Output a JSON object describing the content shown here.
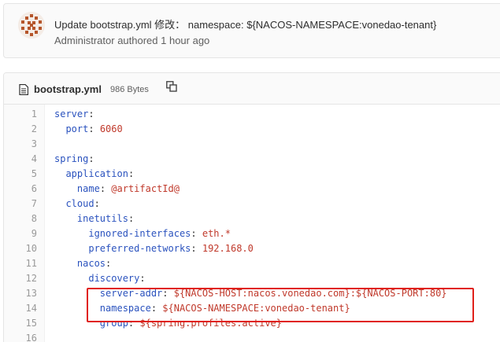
{
  "commit": {
    "title": "Update bootstrap.yml 修改： namespace: ${NACOS-NAMESPACE:vonedao-tenant}",
    "meta": "Administrator authored 1 hour ago",
    "avatar_icon": "identicon-avatar"
  },
  "file": {
    "name": "bootstrap.yml",
    "size": "986 Bytes",
    "icon": "file-icon",
    "copy_icon": "copy-icon"
  },
  "code_lines": [
    {
      "n": "1",
      "indent": "",
      "key": "server",
      "sep": ":",
      "val": ""
    },
    {
      "n": "2",
      "indent": "  ",
      "key": "port",
      "sep": ": ",
      "val": "6060"
    },
    {
      "n": "3",
      "indent": "",
      "key": "",
      "sep": "",
      "val": ""
    },
    {
      "n": "4",
      "indent": "",
      "key": "spring",
      "sep": ":",
      "val": ""
    },
    {
      "n": "5",
      "indent": "  ",
      "key": "application",
      "sep": ":",
      "val": ""
    },
    {
      "n": "6",
      "indent": "    ",
      "key": "name",
      "sep": ": ",
      "val": "@artifactId@"
    },
    {
      "n": "7",
      "indent": "  ",
      "key": "cloud",
      "sep": ":",
      "val": ""
    },
    {
      "n": "8",
      "indent": "    ",
      "key": "inetutils",
      "sep": ":",
      "val": ""
    },
    {
      "n": "9",
      "indent": "      ",
      "key": "ignored-interfaces",
      "sep": ": ",
      "val": "eth.*"
    },
    {
      "n": "10",
      "indent": "      ",
      "key": "preferred-networks",
      "sep": ": ",
      "val": "192.168.0"
    },
    {
      "n": "11",
      "indent": "    ",
      "key": "nacos",
      "sep": ":",
      "val": ""
    },
    {
      "n": "12",
      "indent": "      ",
      "key": "discovery",
      "sep": ":",
      "val": ""
    },
    {
      "n": "13",
      "indent": "        ",
      "key": "server-addr",
      "sep": ": ",
      "val": "${NACOS-HOST:nacos.vonedao.com}:${NACOS-PORT:80}"
    },
    {
      "n": "14",
      "indent": "        ",
      "key": "namespace",
      "sep": ": ",
      "val": "${NACOS-NAMESPACE:vonedao-tenant}"
    },
    {
      "n": "15",
      "indent": "        ",
      "key": "group",
      "sep": ": ",
      "val": "${spring.profiles.active}"
    },
    {
      "n": "16",
      "indent": "        ",
      "key": "",
      "sep": "",
      "val": ""
    }
  ],
  "colors": {
    "key": "#2a52be",
    "value": "#c0392b",
    "highlight_border": "#e0201a"
  }
}
